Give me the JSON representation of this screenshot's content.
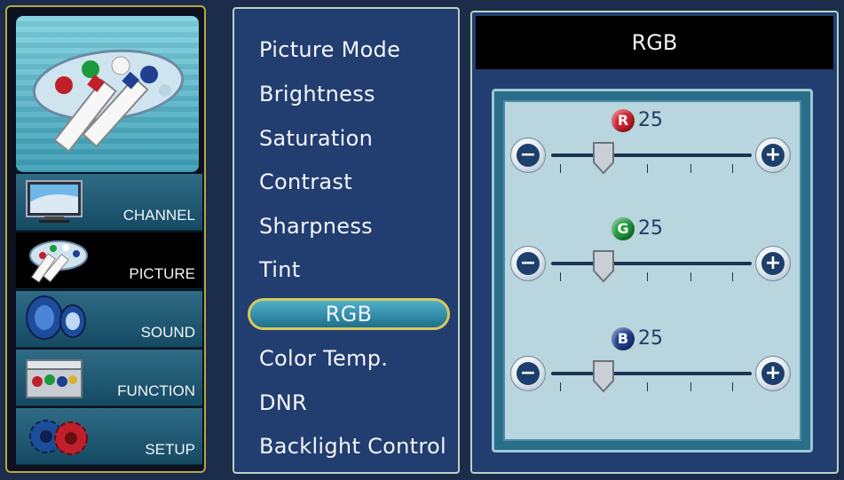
{
  "nav": {
    "items": [
      {
        "label": "CHANNEL",
        "icon": "tv-icon",
        "active": false
      },
      {
        "label": "PICTURE",
        "icon": "palette-icon",
        "active": true
      },
      {
        "label": "SOUND",
        "icon": "speaker-icon",
        "active": false
      },
      {
        "label": "FUNCTION",
        "icon": "toolbox-icon",
        "active": false
      },
      {
        "label": "SETUP",
        "icon": "gears-icon",
        "active": false
      }
    ]
  },
  "menu": {
    "items": [
      "Picture Mode",
      "Brightness",
      "Saturation",
      "Contrast",
      "Sharpness",
      "Tint",
      "RGB",
      "Color Temp.",
      "DNR",
      "Backlight Control"
    ],
    "selected_index": 6
  },
  "rgb": {
    "title": "RGB",
    "channels": [
      {
        "letter": "R",
        "value": "25",
        "color": "#d0202a",
        "level": 0.25
      },
      {
        "letter": "G",
        "value": "25",
        "color": "#1d9a3c",
        "level": 0.25
      },
      {
        "letter": "B",
        "value": "25",
        "color": "#1f3f8f",
        "level": 0.25
      }
    ],
    "minus_glyph": "−",
    "plus_glyph": "+"
  },
  "colors": {
    "accent_gold": "#d7c85b",
    "menu_bg": "#223d70",
    "selected_bg": "#2a86a6"
  }
}
